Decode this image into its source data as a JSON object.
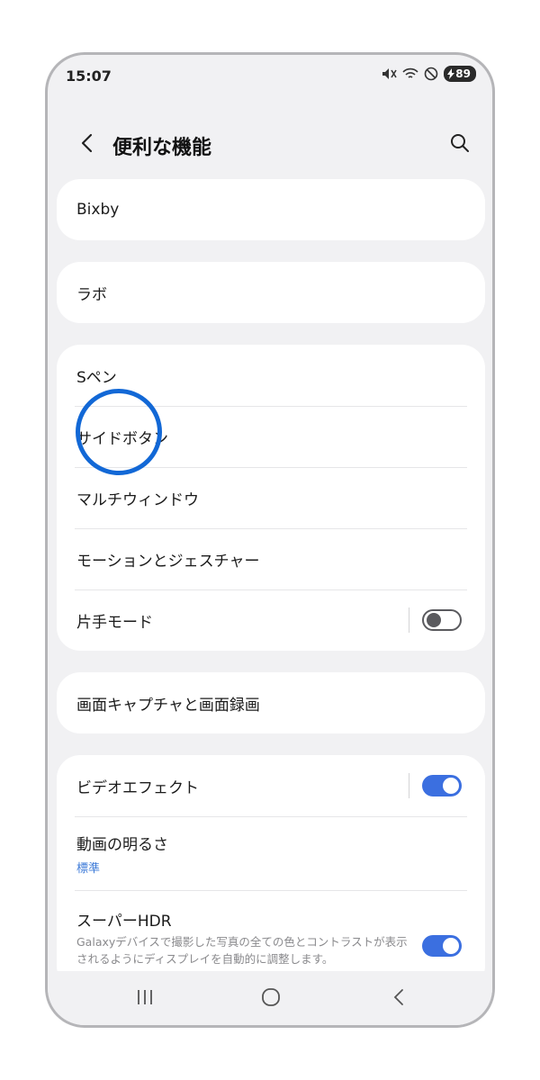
{
  "status": {
    "time": "15:07",
    "battery": "89"
  },
  "header": {
    "title": "便利な機能"
  },
  "cards": {
    "bixby": "Bixby",
    "labs": "ラボ",
    "group1": {
      "spen": "Sペン",
      "side_button": "サイドボタン",
      "multi_window": "マルチウィンドウ",
      "motions": "モーションとジェスチャー",
      "one_hand": "片手モード"
    },
    "screenshots": "画面キャプチャと画面録画",
    "group2": {
      "video_effects": "ビデオエフェクト",
      "video_brightness": "動画の明るさ",
      "video_brightness_value": "標準",
      "super_hdr": "スーパーHDR",
      "super_hdr_desc": "Galaxyデバイスで撮影した写真の全ての色とコントラストが表示されるようにディスプレイを自動的に調整します。"
    }
  },
  "toggles": {
    "one_hand": false,
    "video_effects": true,
    "super_hdr": true
  },
  "colors": {
    "accent": "#3b6fe0",
    "highlight": "#1268d6",
    "background": "#f1f1f3"
  }
}
